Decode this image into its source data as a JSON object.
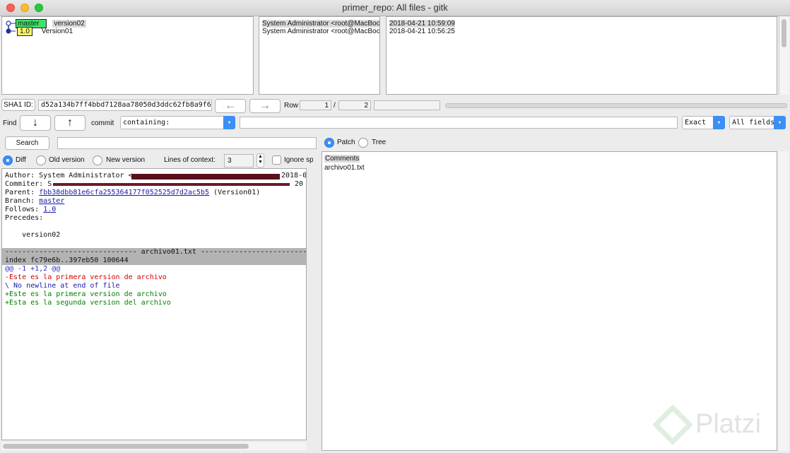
{
  "window": {
    "title": "primer_repo: All files - gitk"
  },
  "history": {
    "commits": [
      {
        "branch": "master",
        "tag": "",
        "message": "version02",
        "author": "System Administrator <root@MacBook",
        "date": "2018-04-21 10:59:09"
      },
      {
        "branch": "",
        "tag": "1.0",
        "message": "Version01",
        "author": "System Administrator <root@MacBook",
        "date": "2018-04-21 10:56:25"
      }
    ]
  },
  "sha": {
    "label": "SHA1 ID:",
    "value": "d52a134b7ff4bbd7128aa78050d3ddc62fb8a9f6",
    "row_label": "Row",
    "row_current": "1",
    "row_sep": "/",
    "row_total": "2"
  },
  "find": {
    "label": "Find",
    "type": "commit",
    "mode": "containing:",
    "match": "Exact",
    "fields": "All fields"
  },
  "search": {
    "button": "Search"
  },
  "diff_options": {
    "diff": "Diff",
    "old": "Old version",
    "new": "New version",
    "context_label": "Lines of context:",
    "context_value": "3",
    "ignore": "Ignore sp"
  },
  "details": {
    "author": "Author: System Administrator <",
    "author_tail": "2018-0",
    "committer": "Commiter: S",
    "committer_tail": "20",
    "parent_label": "Parent: ",
    "parent_sha": "fbb38dbb81e6cfa255364177f052525d7d2ac5b5",
    "parent_msg": " (Version01)",
    "branch_label": "Branch: ",
    "branch": "master",
    "follows_label": "Follows: ",
    "follows": "1.0",
    "precedes_label": "Precedes:",
    "message": "    version02",
    "file_header": "------------------------------- archivo01.txt ----------------------------",
    "index_line": "index fc79e6b..397eb50 100644",
    "hunk": "@@ -1 +1,2 @@",
    "removed": "-Este es la primera version de archivo",
    "no_newline": "\\ No newline at end of file",
    "added1": "+Este es la primera version de archivo",
    "added2": "+Esta es la segunda version del archivo"
  },
  "files": {
    "patch": "Patch",
    "tree": "Tree",
    "items": [
      "Comments",
      "archivo01.txt"
    ]
  },
  "watermark": "Platzi",
  "colors": {
    "branch": "#3ee36a",
    "tag": "#f7f36b",
    "removed": "#d40000",
    "added": "#008000",
    "hunk": "#3030c8",
    "accent": "#3b8ff5"
  }
}
